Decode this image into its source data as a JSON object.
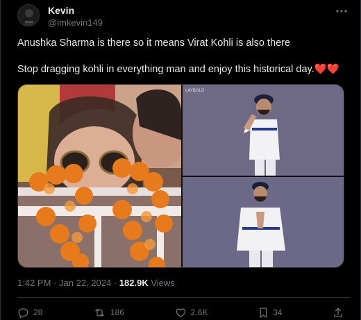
{
  "author": {
    "name": "Kevin",
    "handle": "@imkevin149"
  },
  "tweet": {
    "line1": "Anushka Sharma is there so it means Virat Kohli is also there",
    "line2": "Stop dragging kohli in everything man and enjoy this historical day.",
    "emoji": "❤️❤️"
  },
  "media": {
    "watermark": "LAYBOLD"
  },
  "meta": {
    "time": "1:42 PM",
    "separator": "·",
    "date": "Jan 22, 2024",
    "views_count": "182.9K",
    "views_label": "Views"
  },
  "actions": {
    "replies": "28",
    "reposts": "186",
    "likes": "2.6K",
    "bookmarks": "34"
  },
  "colors": {
    "background": "#000000",
    "text": "#e7e9ea",
    "muted": "#71767b",
    "border": "#2f3336",
    "heart": "#e0245e"
  },
  "icons": [
    "more-icon",
    "reply-icon",
    "repost-icon",
    "like-icon",
    "bookmark-icon",
    "share-icon"
  ]
}
